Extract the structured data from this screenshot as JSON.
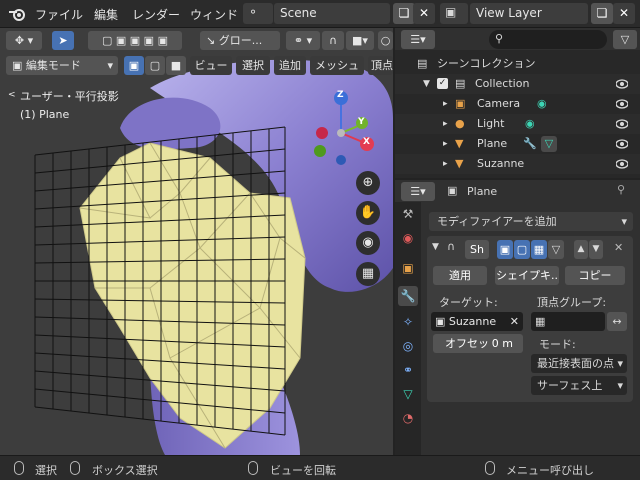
{
  "topbar": {
    "menus": [
      "ファイル",
      "編集",
      "レンダー",
      "ウィンド"
    ],
    "scene_name": "Scene",
    "view_layer_name": "View Layer"
  },
  "viewport": {
    "mode": "編集モード",
    "transform_orientation": "グロー...",
    "header_menus": [
      "ビュー",
      "選択",
      "追加",
      "メッシュ",
      "頂点"
    ],
    "view_label": "ユーザー・平行投影",
    "object_label": "(1) Plane",
    "gizmo_axes": [
      "Z",
      "Y",
      "X"
    ]
  },
  "outliner": {
    "title": "シーンコレクション",
    "items": [
      {
        "label": "Collection",
        "icon": "collection-icon"
      },
      {
        "label": "Camera",
        "icon": "camera-icon"
      },
      {
        "label": "Light",
        "icon": "light-icon"
      },
      {
        "label": "Plane",
        "icon": "mesh-icon"
      },
      {
        "label": "Suzanne",
        "icon": "mesh-icon"
      }
    ]
  },
  "properties": {
    "object_name": "Plane",
    "add_modifier": "モディファイアーを追加",
    "modifier_name": "Sh",
    "apply": "適用",
    "shape_key": "シェイプキ..",
    "copy": "コピー",
    "target_label": "ターゲット:",
    "target_value": "Suzanne",
    "vertex_group_label": "頂点グループ:",
    "offset_label": "オフセッ",
    "offset_value": "0 m",
    "mode_label": "モード:",
    "mode_value": "最近接表面の点",
    "surface_value": "サーフェス上"
  },
  "statusbar": {
    "select": "選択",
    "box_select": "ボックス選択",
    "rotate_view": "ビューを回転",
    "call_menu": "メニュー呼び出し"
  },
  "colors": {
    "accent": "#4772b3",
    "suzanne": "#8a7fd0",
    "plane_yellow": "#e8e3a0",
    "viewport_bg": "#3d3d3d"
  }
}
